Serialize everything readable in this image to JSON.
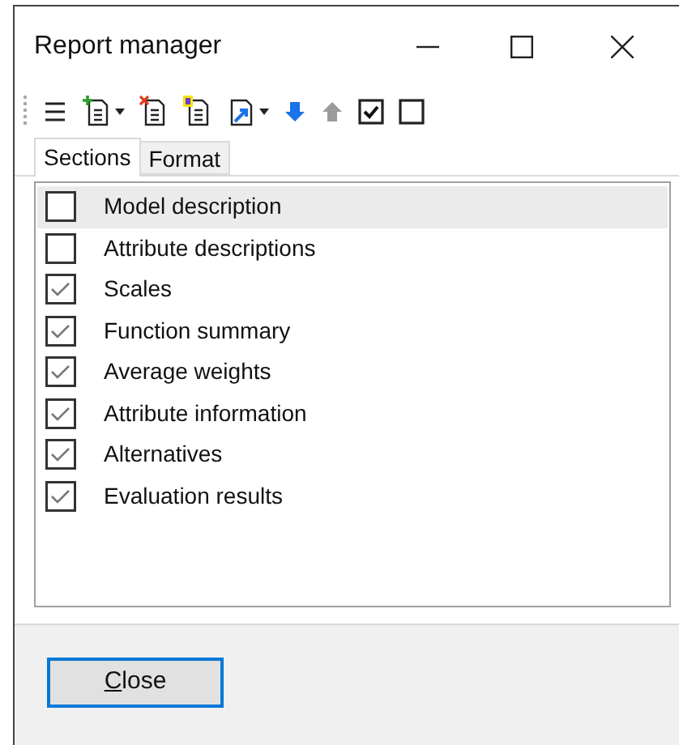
{
  "window": {
    "title": "Report manager"
  },
  "toolbar": [
    {
      "kind": "menu"
    },
    {
      "kind": "add",
      "dropdown": true
    },
    {
      "kind": "delete"
    },
    {
      "kind": "number"
    },
    {
      "kind": "export",
      "dropdown": true
    },
    {
      "kind": "down",
      "disabled": false
    },
    {
      "kind": "up",
      "disabled": true
    },
    {
      "kind": "check-all"
    },
    {
      "kind": "uncheck-all"
    }
  ],
  "tabs": [
    {
      "label": "Sections",
      "selected": true
    },
    {
      "label": "Format",
      "selected": false
    }
  ],
  "sections": [
    {
      "label": "Model description",
      "checked": false,
      "selected": true
    },
    {
      "label": "Attribute descriptions",
      "checked": false,
      "selected": false
    },
    {
      "label": "Scales",
      "checked": true,
      "selected": false
    },
    {
      "label": "Function summary",
      "checked": true,
      "selected": false
    },
    {
      "label": "Average weights",
      "checked": true,
      "selected": false
    },
    {
      "label": "Attribute information",
      "checked": true,
      "selected": false
    },
    {
      "label": "Alternatives",
      "checked": true,
      "selected": false
    },
    {
      "label": "Evaluation results",
      "checked": true,
      "selected": false
    }
  ],
  "buttons": [
    {
      "label": "Close",
      "mnemonic_underlined": true,
      "default": true
    }
  ]
}
